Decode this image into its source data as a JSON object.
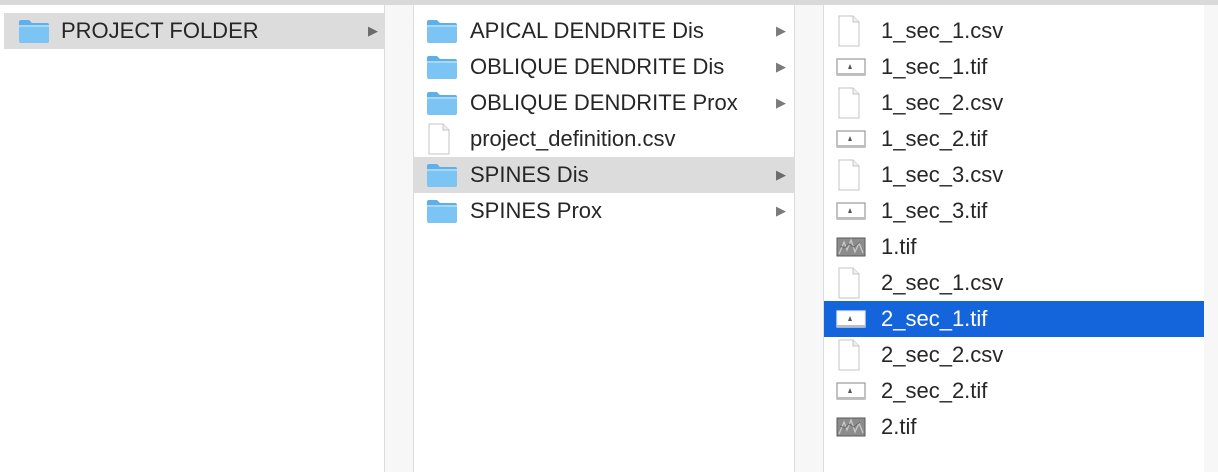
{
  "columns": [
    {
      "items": [
        {
          "name": "PROJECT FOLDER",
          "kind": "folder",
          "has_children": true,
          "selected": "gray"
        }
      ]
    },
    {
      "items": [
        {
          "name": "APICAL DENDRITE Dis",
          "kind": "folder",
          "has_children": true,
          "selected": ""
        },
        {
          "name": "OBLIQUE DENDRITE Dis",
          "kind": "folder",
          "has_children": true,
          "selected": ""
        },
        {
          "name": "OBLIQUE DENDRITE Prox",
          "kind": "folder",
          "has_children": true,
          "selected": ""
        },
        {
          "name": "project_definition.csv",
          "kind": "document",
          "has_children": false,
          "selected": ""
        },
        {
          "name": "SPINES Dis",
          "kind": "folder",
          "has_children": true,
          "selected": "gray"
        },
        {
          "name": "SPINES Prox",
          "kind": "folder",
          "has_children": true,
          "selected": ""
        }
      ]
    },
    {
      "items": [
        {
          "name": "1_sec_1.csv",
          "kind": "document",
          "selected": ""
        },
        {
          "name": "1_sec_1.tif",
          "kind": "image-thumb",
          "selected": ""
        },
        {
          "name": "1_sec_2.csv",
          "kind": "document",
          "selected": ""
        },
        {
          "name": "1_sec_2.tif",
          "kind": "image-thumb",
          "selected": ""
        },
        {
          "name": "1_sec_3.csv",
          "kind": "document",
          "selected": ""
        },
        {
          "name": "1_sec_3.tif",
          "kind": "image-thumb",
          "selected": ""
        },
        {
          "name": "1.tif",
          "kind": "image-texture",
          "selected": ""
        },
        {
          "name": "2_sec_1.csv",
          "kind": "document",
          "selected": ""
        },
        {
          "name": "2_sec_1.tif",
          "kind": "image-thumb",
          "selected": "blue"
        },
        {
          "name": "2_sec_2.csv",
          "kind": "document",
          "selected": ""
        },
        {
          "name": "2_sec_2.tif",
          "kind": "image-thumb",
          "selected": ""
        },
        {
          "name": "2.tif",
          "kind": "image-texture",
          "selected": ""
        }
      ]
    }
  ],
  "icons": {
    "folder": "folder-icon",
    "document": "document-icon",
    "image-thumb": "image-file-icon",
    "image-texture": "image-file-icon",
    "arrow": "chevron-right-icon"
  },
  "colors": {
    "selection_gray": "#dcdcdc",
    "selection_blue": "#1464dc",
    "folder": "#7cc4f4"
  },
  "arrow_glyph": "▶"
}
